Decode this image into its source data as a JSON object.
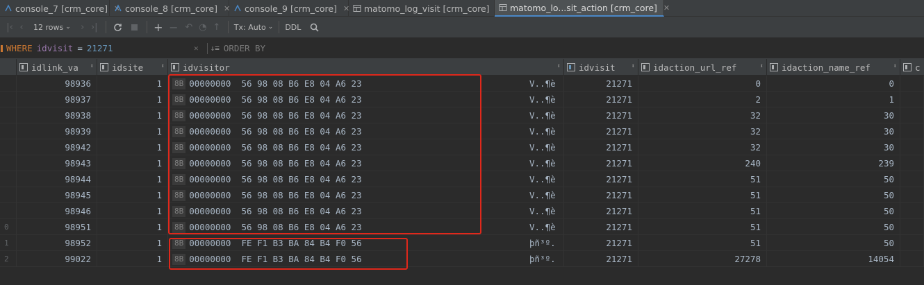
{
  "tabs": [
    {
      "label": "console_7 [crm_core]",
      "icon": "console-icon",
      "active": false
    },
    {
      "label": "console_8 [crm_core]",
      "icon": "console-icon",
      "active": false
    },
    {
      "label": "console_9 [crm_core]",
      "icon": "console-icon",
      "active": false
    },
    {
      "label": "matomo_log_visit [crm_core]",
      "icon": "table-icon",
      "active": false
    },
    {
      "label": "matomo_lo...sit_action [crm_core]",
      "icon": "table-icon",
      "active": true
    }
  ],
  "toolbar": {
    "rows_label": "12 rows",
    "tx_label": "Tx: Auto",
    "ddl_label": "DDL"
  },
  "filter": {
    "where_kw": "WHERE",
    "where_field": "idvisit",
    "where_op": "=",
    "where_value": "21271",
    "orderby_label": "ORDER BY"
  },
  "columns": [
    {
      "name": "idlink_va"
    },
    {
      "name": "idsite"
    },
    {
      "name": "idvisitor"
    },
    {
      "name": "idvisit"
    },
    {
      "name": "idaction_url_ref"
    },
    {
      "name": "idaction_name_ref"
    },
    {
      "name": "c"
    }
  ],
  "rows": [
    {
      "num": "",
      "idlink": "98936",
      "idsite": "1",
      "badge": "8B",
      "hex": "00000000  56 98 08 B6 E8 04 A6 23",
      "text": "V..¶è",
      "idvisit": "21271",
      "url_ref": "0",
      "name_ref": "0"
    },
    {
      "num": "",
      "idlink": "98937",
      "idsite": "1",
      "badge": "8B",
      "hex": "00000000  56 98 08 B6 E8 04 A6 23",
      "text": "V..¶è",
      "idvisit": "21271",
      "url_ref": "2",
      "name_ref": "1"
    },
    {
      "num": "",
      "idlink": "98938",
      "idsite": "1",
      "badge": "8B",
      "hex": "00000000  56 98 08 B6 E8 04 A6 23",
      "text": "V..¶è",
      "idvisit": "21271",
      "url_ref": "32",
      "name_ref": "30"
    },
    {
      "num": "",
      "idlink": "98939",
      "idsite": "1",
      "badge": "8B",
      "hex": "00000000  56 98 08 B6 E8 04 A6 23",
      "text": "V..¶è",
      "idvisit": "21271",
      "url_ref": "32",
      "name_ref": "30"
    },
    {
      "num": "",
      "idlink": "98942",
      "idsite": "1",
      "badge": "8B",
      "hex": "00000000  56 98 08 B6 E8 04 A6 23",
      "text": "V..¶è",
      "idvisit": "21271",
      "url_ref": "32",
      "name_ref": "30"
    },
    {
      "num": "",
      "idlink": "98943",
      "idsite": "1",
      "badge": "8B",
      "hex": "00000000  56 98 08 B6 E8 04 A6 23",
      "text": "V..¶è",
      "idvisit": "21271",
      "url_ref": "240",
      "name_ref": "239"
    },
    {
      "num": "",
      "idlink": "98944",
      "idsite": "1",
      "badge": "8B",
      "hex": "00000000  56 98 08 B6 E8 04 A6 23",
      "text": "V..¶è",
      "idvisit": "21271",
      "url_ref": "51",
      "name_ref": "50"
    },
    {
      "num": "",
      "idlink": "98945",
      "idsite": "1",
      "badge": "8B",
      "hex": "00000000  56 98 08 B6 E8 04 A6 23",
      "text": "V..¶è",
      "idvisit": "21271",
      "url_ref": "51",
      "name_ref": "50"
    },
    {
      "num": "",
      "idlink": "98946",
      "idsite": "1",
      "badge": "8B",
      "hex": "00000000  56 98 08 B6 E8 04 A6 23",
      "text": "V..¶è",
      "idvisit": "21271",
      "url_ref": "51",
      "name_ref": "50"
    },
    {
      "num": "0",
      "idlink": "98951",
      "idsite": "1",
      "badge": "8B",
      "hex": "00000000  56 98 08 B6 E8 04 A6 23",
      "text": "V..¶è",
      "idvisit": "21271",
      "url_ref": "51",
      "name_ref": "50"
    },
    {
      "num": "1",
      "idlink": "98952",
      "idsite": "1",
      "badge": "8B",
      "hex": "00000000  FE F1 B3 BA 84 B4 F0 56",
      "text": "þñ³º.",
      "idvisit": "21271",
      "url_ref": "51",
      "name_ref": "50"
    },
    {
      "num": "2",
      "idlink": "99022",
      "idsite": "1",
      "badge": "8B",
      "hex": "00000000  FE F1 B3 BA 84 B4 F0 56",
      "text": "þñ³º.",
      "idvisit": "21271",
      "url_ref": "27278",
      "name_ref": "14054"
    }
  ],
  "colors": {
    "highlight": "#e0281b",
    "active_tab_underline": "#4a88c7"
  }
}
